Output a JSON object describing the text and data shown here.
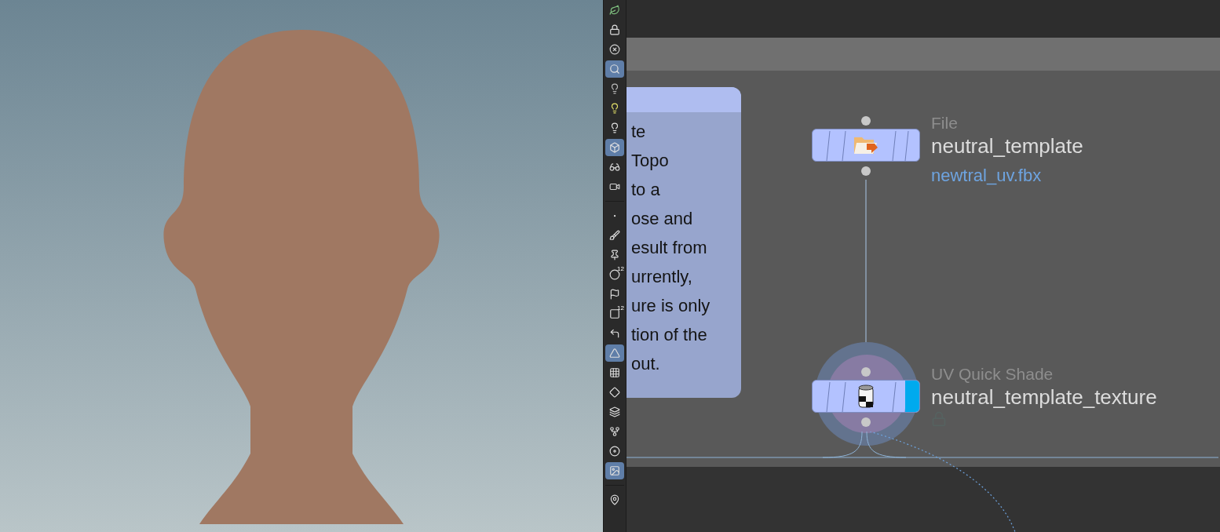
{
  "toolbar": {
    "tools": [
      {
        "selected": false
      },
      {
        "selected": false
      },
      {
        "selected": false
      },
      {
        "selected": true
      },
      {
        "selected": false
      },
      {
        "selected": false
      },
      {
        "selected": false
      },
      {
        "selected": true
      },
      {
        "selected": false
      },
      {
        "selected": false
      },
      {
        "selected": false
      },
      {
        "selected": false
      },
      {
        "selected": false
      },
      {
        "selected": false,
        "badge": "12"
      },
      {
        "selected": false
      },
      {
        "selected": false,
        "badge": "12"
      },
      {
        "selected": false
      },
      {
        "selected": true
      },
      {
        "selected": false
      },
      {
        "selected": false
      },
      {
        "selected": false
      },
      {
        "selected": false
      },
      {
        "selected": false
      },
      {
        "selected": true
      },
      {
        "selected": false
      }
    ]
  },
  "network": {
    "sticky_note": {
      "text_lines": [
        "te",
        "Topo",
        "to a",
        "ose and",
        "esult from",
        "urrently,",
        "ure is only",
        "tion of the",
        "out."
      ]
    },
    "nodes": [
      {
        "kind": "file",
        "type_label": "File",
        "name": "neutral_template",
        "parameter": "newtral_uv.fbx",
        "display_flag": false,
        "current": false,
        "locked": false
      },
      {
        "kind": "shade",
        "type_label": "UV Quick Shade",
        "name": "neutral_template_texture",
        "display_flag": true,
        "current": true,
        "locked": true
      }
    ]
  }
}
